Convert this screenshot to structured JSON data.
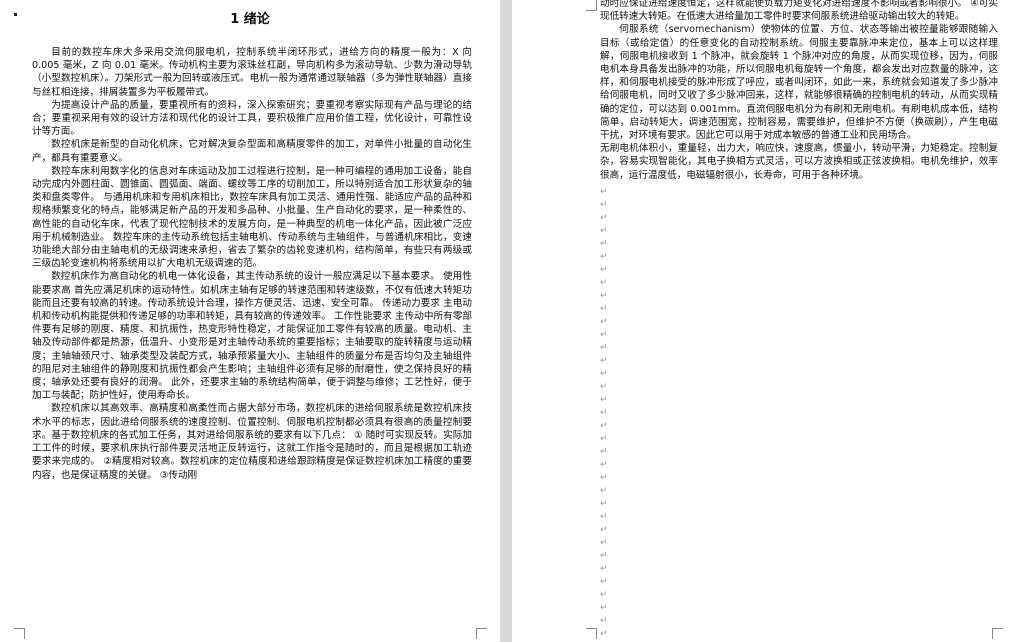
{
  "left_page": {
    "heading": "1  绪论",
    "paragraphs": [
      "目前的数控车床大多采用交流伺服电机，控制系统半闭环形式，进给方向的精度一般为：X 向 0.005 毫米，Z 向 0.01 毫米。传动机构主要为滚珠丝杠副，导向机构多为滚动导轨、少数为滑动导轨（小型数控机床）。刀架形式一般为回转或液压式。电机一般为通常通过联轴器（多为弹性联轴器）直接与丝杠相连接，排屑装置多为平板履带式。",
      "为提高设计产品的质量，要重视所有的资料，深入探索研究；要重视考察实际现有产品与理论的结合；要重视采用有效的设计方法和现代化的设计工具，要积极推广应用价值工程，优化设计，可靠性设计等方面。",
      "数控机床是新型的自动化机床，它对解决复杂型面和高精度零件的加工，对单件小批量的自动化生产，都具有重要意义。",
      "数控车床利用数字化的信息对车床运动及加工过程进行控制，是一种可编程的通用加工设备，能自动完成内外圆柱面、圆锥面、圆弧面、端面、螺纹等工序的切削加工，所以特别适合加工形状复杂的轴类和盘类零件。 与通用机床和专用机床相比，数控车床具有加工灵活、通用性强、能适应产品的品种和规格频繁变化的特点，能够满足新产品的开发和多品种、小批量、生产自动化的要求，是一种柔性的、高性能的自动化车床，代表了现代控制技术的发展方向，是一种典型的机电一体化产品，因此被广泛应用于机械制造业。 数控车床的主传动系统包括主轴电机、传动系统与主轴组件，与普通机床相比，变速功能绝大部分由主轴电机的无级调速来承担，省去了繁杂的齿轮变速机构，结构简单，有些只有两级或三级齿轮变速机构将系统用以扩大电机无级调速的范。",
      "数控机床作为高自动化的机电一体化设备，其主传动系统的设计一般应满足以下基本要求。 使用性能要求高 首先应满足机床的运动特性。如机床主轴有足够的转速范围和转速级数，不仅有低速大转矩功能而且还要有较高的转速。传动系统设计合理，操作方便灵活、迅速、安全可靠。 传递动力要求 主电动机和传动机构能提供和传递足够的功率和转矩，具有较高的传递效率。 工作性能要求 主传动中所有零部件要有足够的刚度、精度、和抗振性，热变形特性稳定，才能保证加工零件有较高的质量。电动机、主轴及传动部件都是热源，低温升、小变形是对主轴传动系统的重要指标；主轴要取的旋转精度与运动精度；主轴轴颈尺寸、轴承类型及装配方式，轴承预紧量大小、主轴组件的质量分布是否均匀及主轴组件的阻尼对主轴组件的静刚度和抗振性都会产生影响；主轴组件必须有足够的耐磨性，使之保持良好的精度；轴承处还要有良好的润滑。 此外，还要求主轴的系统结构简单，便于调整与维修；工艺性好，便于加工与装配；防护性好，使用寿命长。",
      "数控机床以其高效率、高精度和高柔性而占据大部分市场，数控机床的进给伺服系统是数控机床技术水平的标志，因此进给伺服系统的速度控制、位置控制、伺服电机控制都必须具有很高的质量控制要求。基于数控机床的各式加工任务，其对进给伺服系统的要求有以下几点： ① 随时可实现反转。实际加工工件的时候，要求机床执行部件要灵活地正反转运行，这就工作指令是随时的，而且是根据加工轨迹要求来完成的。 ②精度相对较高。数控机床的定位精度和进给跟踪精度是保证数控机床加工精度的重要内容，也是保证精度的关键。 ③传动刚"
    ]
  },
  "right_page": {
    "paragraphs": [
      "动时应保证进给速度恒定，这样就能使负载力矩变化对进给速度不影响或者影响很小。 ④可实现低转速大转矩。在低速大进给量加工零件时要求伺服系统进给驱动输出较大的转矩。",
      "伺服系统（servomechanism）使物体的位置、方位、状态等输出被控量能够跟随输入目标（或给定值）的任意变化的自动控制系统。伺服主要靠脉冲来定位，基本上可以这样理解，伺服电机接收到 1 个脉冲，就会旋转 1 个脉冲对应的角度，从而实现位移，因为，伺服电机本身具备发出脉冲的功能，所以伺服电机每旋转一个角度，都会发出对应数量的脉冲，这样，和伺服电机接受的脉冲形成了呼应，或者叫闭环，如此一来，系统就会知道发了多少脉冲给伺服电机，同时又收了多少脉冲回来，这样，就能够很精确的控制电机的转动，从而实现精确的定位，可以达到 0.001mm。直流伺服电机分为有刷和无刷电机。有刷电机成本低，结构简单，启动转矩大，调速范围宽，控制容易，需要维护，但维护不方便（换碳刷），产生电磁干扰，对环境有要求。因此它可以用于对成本敏感的普通工业和民用场合。",
      "无刷电机体积小，重量轻，出力大，响应快，速度高，惯量小，转动平滑，力矩稳定。控制复杂，容易实现智能化，其电子换相方式灵活，可以方波换相或正弦波换相。电机免维护，效率很高，运行温度低，电磁辐射很小，长寿命，可用于各种环境。"
    ]
  }
}
